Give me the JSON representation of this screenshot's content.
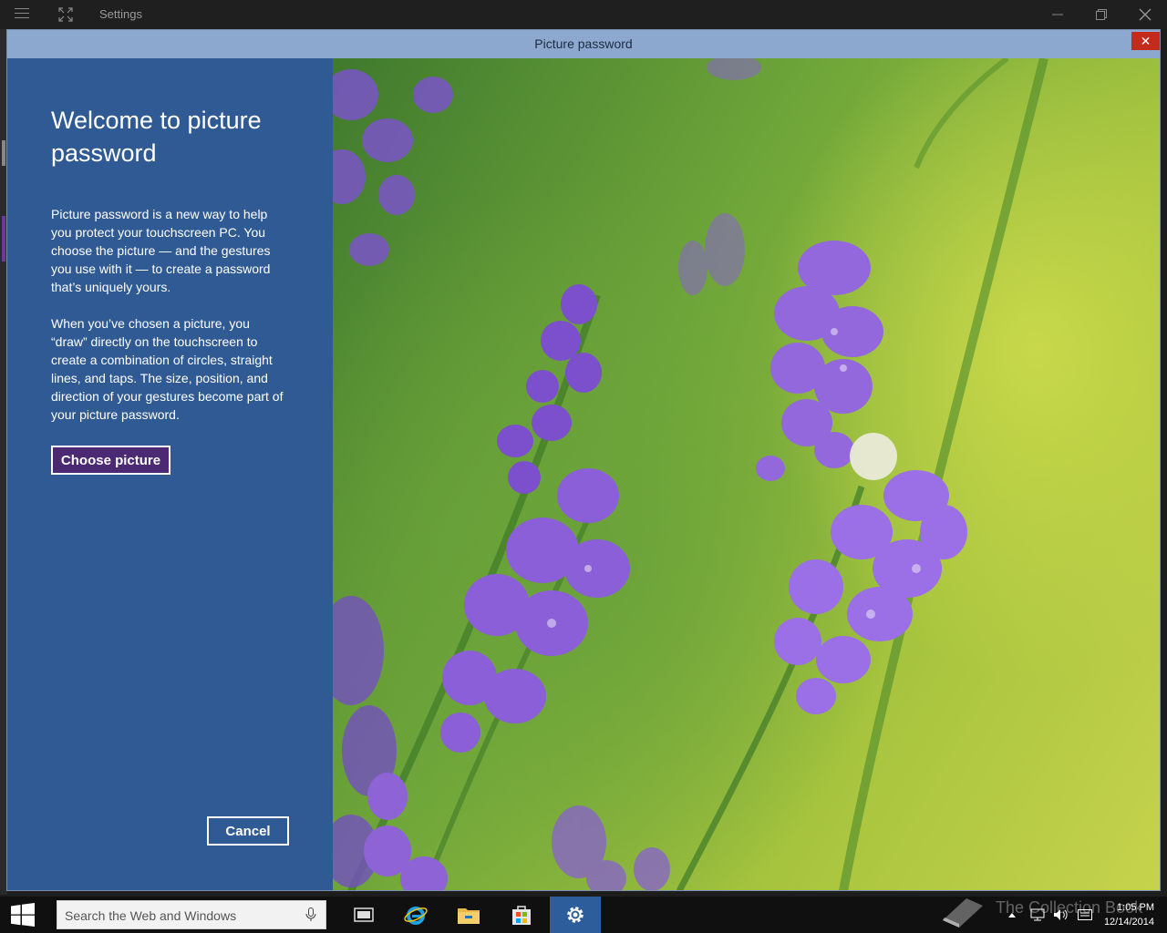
{
  "app": {
    "title": "Settings"
  },
  "dialog": {
    "title": "Picture password",
    "close_glyph": "✕",
    "heading": "Welcome to picture password",
    "paragraph1": "Picture password is a new way to help you protect your touchscreen PC. You choose the picture — and the gestures you use with it — to create a password that’s uniquely yours.",
    "paragraph2": "When you’ve chosen a picture, you “draw” directly on the touchscreen to create a combination of circles, straight lines, and taps. The size, position, and direction of your gestures become part of your picture password.",
    "choose_label": "Choose picture",
    "cancel_label": "Cancel"
  },
  "taskbar": {
    "search_placeholder": "Search the Web and Windows",
    "clock_time": "1:05 PM",
    "clock_date": "12/14/2014",
    "watermark": "The Collection Book"
  },
  "colors": {
    "panel_blue": "#2f5a94",
    "dialog_titlebar": "#8da8cf",
    "choose_button": "#4b2a73",
    "close_red": "#c42b1c",
    "taskbar_active": "#2d5d9a"
  }
}
